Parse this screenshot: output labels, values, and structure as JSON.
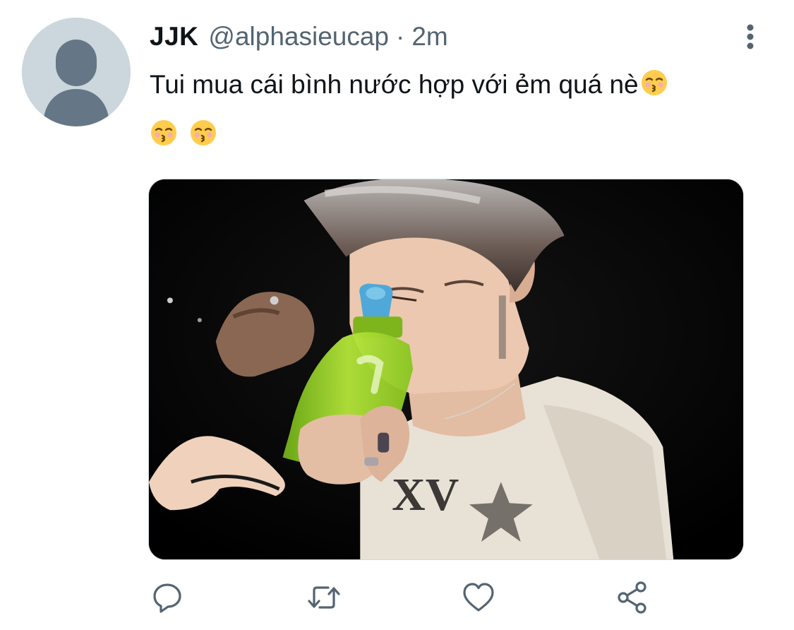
{
  "tweet": {
    "display_name": "JJK",
    "handle": "@alphasieucap",
    "separator": "·",
    "time": "2m",
    "text": "Tui mua cái bình nước hợp với ẻm quá nè"
  },
  "icons": {
    "avatar": "default-user-icon",
    "more": "vertical-ellipsis-icon",
    "emoji": "kissing-face-with-closed-eyes-emoji",
    "reply": "reply-bubble-icon",
    "retweet": "retweet-icon",
    "like": "heart-icon",
    "share": "share-icon"
  },
  "colors": {
    "text": "#0f1419",
    "secondary": "#536471",
    "avatar_bg": "#ccd6dd",
    "avatar_figure": "#657786"
  }
}
